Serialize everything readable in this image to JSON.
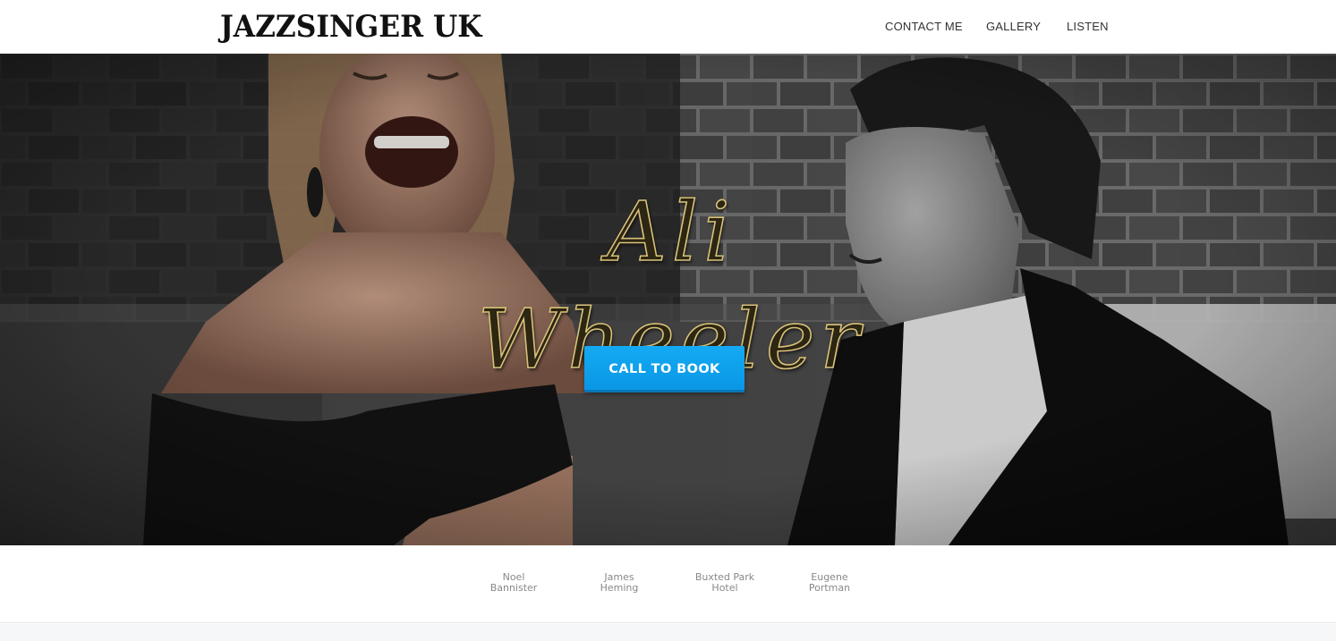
{
  "header": {
    "logo": "JAZZSINGER UK",
    "nav": [
      {
        "label": "CONTACT ME"
      },
      {
        "label": "GALLERY"
      },
      {
        "label": "LISTEN"
      }
    ]
  },
  "hero": {
    "title": "Ali Wheeler",
    "cta_label": "CALL TO BOOK"
  },
  "references": [
    {
      "line1": "Noel",
      "line2": "Bannister"
    },
    {
      "line1": "James",
      "line2": "Heming"
    },
    {
      "line1": "Buxted Park",
      "line2": "Hotel"
    },
    {
      "line1": "Eugene",
      "line2": "Portman"
    }
  ],
  "colors": {
    "cta": "#0a9fea",
    "title_gold": "#d9c27a",
    "nav_text": "#333333"
  }
}
